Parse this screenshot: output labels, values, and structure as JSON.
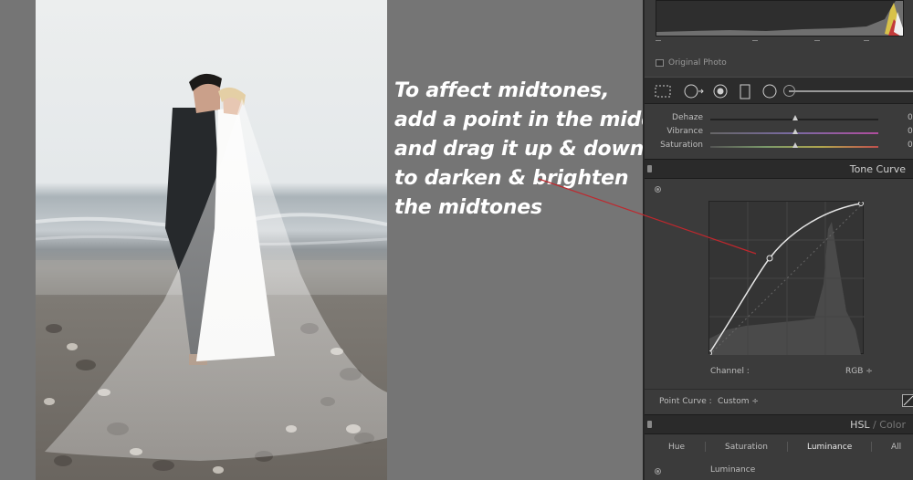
{
  "annotation": {
    "lines": [
      "To affect midtones,",
      "add a point in the middle",
      "and drag it up & down",
      "to darken & brighten",
      "the midtones"
    ]
  },
  "panel": {
    "original_photo_label": "Original Photo",
    "basic": [
      {
        "label": "Dehaze",
        "value": "0",
        "level": 0.5
      },
      {
        "label": "Vibrance",
        "value": "0",
        "level": 0.5
      },
      {
        "label": "Saturation",
        "value": "0",
        "level": 0.5
      }
    ],
    "tone_curve": {
      "title": "Tone Curve",
      "channel_label": "Channel :",
      "channel_value": "RGB",
      "point_curve_label": "Point Curve :",
      "point_curve_value": "Custom"
    },
    "hsl": {
      "title_main": "HSL",
      "title_sep": " / ",
      "title_dim": "Color",
      "tabs": [
        "Hue",
        "Saturation",
        "Luminance",
        "All"
      ],
      "active_tab": "Luminance",
      "sub_label": "Luminance"
    }
  },
  "colors": {
    "annotation_line": "#c0272d",
    "panel_bg": "#3b3b3b",
    "page_bg": "#757575"
  }
}
